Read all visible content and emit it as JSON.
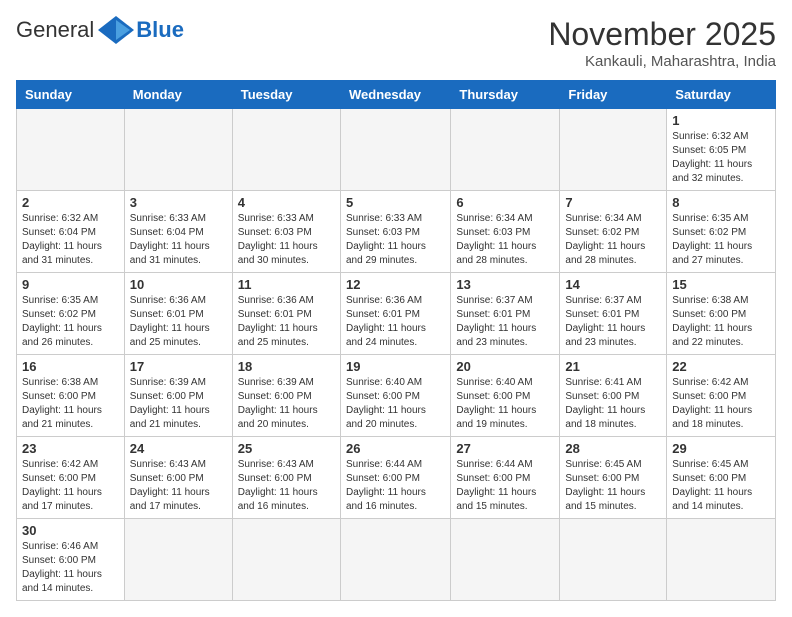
{
  "header": {
    "logo_general": "General",
    "logo_blue": "Blue",
    "month_year": "November 2025",
    "location": "Kankauli, Maharashtra, India"
  },
  "days_of_week": [
    "Sunday",
    "Monday",
    "Tuesday",
    "Wednesday",
    "Thursday",
    "Friday",
    "Saturday"
  ],
  "weeks": [
    [
      {
        "day": "",
        "content": ""
      },
      {
        "day": "",
        "content": ""
      },
      {
        "day": "",
        "content": ""
      },
      {
        "day": "",
        "content": ""
      },
      {
        "day": "",
        "content": ""
      },
      {
        "day": "",
        "content": ""
      },
      {
        "day": "1",
        "content": "Sunrise: 6:32 AM\nSunset: 6:05 PM\nDaylight: 11 hours\nand 32 minutes."
      }
    ],
    [
      {
        "day": "2",
        "content": "Sunrise: 6:32 AM\nSunset: 6:04 PM\nDaylight: 11 hours\nand 31 minutes."
      },
      {
        "day": "3",
        "content": "Sunrise: 6:33 AM\nSunset: 6:04 PM\nDaylight: 11 hours\nand 31 minutes."
      },
      {
        "day": "4",
        "content": "Sunrise: 6:33 AM\nSunset: 6:03 PM\nDaylight: 11 hours\nand 30 minutes."
      },
      {
        "day": "5",
        "content": "Sunrise: 6:33 AM\nSunset: 6:03 PM\nDaylight: 11 hours\nand 29 minutes."
      },
      {
        "day": "6",
        "content": "Sunrise: 6:34 AM\nSunset: 6:03 PM\nDaylight: 11 hours\nand 28 minutes."
      },
      {
        "day": "7",
        "content": "Sunrise: 6:34 AM\nSunset: 6:02 PM\nDaylight: 11 hours\nand 28 minutes."
      },
      {
        "day": "8",
        "content": "Sunrise: 6:35 AM\nSunset: 6:02 PM\nDaylight: 11 hours\nand 27 minutes."
      }
    ],
    [
      {
        "day": "9",
        "content": "Sunrise: 6:35 AM\nSunset: 6:02 PM\nDaylight: 11 hours\nand 26 minutes."
      },
      {
        "day": "10",
        "content": "Sunrise: 6:36 AM\nSunset: 6:01 PM\nDaylight: 11 hours\nand 25 minutes."
      },
      {
        "day": "11",
        "content": "Sunrise: 6:36 AM\nSunset: 6:01 PM\nDaylight: 11 hours\nand 25 minutes."
      },
      {
        "day": "12",
        "content": "Sunrise: 6:36 AM\nSunset: 6:01 PM\nDaylight: 11 hours\nand 24 minutes."
      },
      {
        "day": "13",
        "content": "Sunrise: 6:37 AM\nSunset: 6:01 PM\nDaylight: 11 hours\nand 23 minutes."
      },
      {
        "day": "14",
        "content": "Sunrise: 6:37 AM\nSunset: 6:01 PM\nDaylight: 11 hours\nand 23 minutes."
      },
      {
        "day": "15",
        "content": "Sunrise: 6:38 AM\nSunset: 6:00 PM\nDaylight: 11 hours\nand 22 minutes."
      }
    ],
    [
      {
        "day": "16",
        "content": "Sunrise: 6:38 AM\nSunset: 6:00 PM\nDaylight: 11 hours\nand 21 minutes."
      },
      {
        "day": "17",
        "content": "Sunrise: 6:39 AM\nSunset: 6:00 PM\nDaylight: 11 hours\nand 21 minutes."
      },
      {
        "day": "18",
        "content": "Sunrise: 6:39 AM\nSunset: 6:00 PM\nDaylight: 11 hours\nand 20 minutes."
      },
      {
        "day": "19",
        "content": "Sunrise: 6:40 AM\nSunset: 6:00 PM\nDaylight: 11 hours\nand 20 minutes."
      },
      {
        "day": "20",
        "content": "Sunrise: 6:40 AM\nSunset: 6:00 PM\nDaylight: 11 hours\nand 19 minutes."
      },
      {
        "day": "21",
        "content": "Sunrise: 6:41 AM\nSunset: 6:00 PM\nDaylight: 11 hours\nand 18 minutes."
      },
      {
        "day": "22",
        "content": "Sunrise: 6:42 AM\nSunset: 6:00 PM\nDaylight: 11 hours\nand 18 minutes."
      }
    ],
    [
      {
        "day": "23",
        "content": "Sunrise: 6:42 AM\nSunset: 6:00 PM\nDaylight: 11 hours\nand 17 minutes."
      },
      {
        "day": "24",
        "content": "Sunrise: 6:43 AM\nSunset: 6:00 PM\nDaylight: 11 hours\nand 17 minutes."
      },
      {
        "day": "25",
        "content": "Sunrise: 6:43 AM\nSunset: 6:00 PM\nDaylight: 11 hours\nand 16 minutes."
      },
      {
        "day": "26",
        "content": "Sunrise: 6:44 AM\nSunset: 6:00 PM\nDaylight: 11 hours\nand 16 minutes."
      },
      {
        "day": "27",
        "content": "Sunrise: 6:44 AM\nSunset: 6:00 PM\nDaylight: 11 hours\nand 15 minutes."
      },
      {
        "day": "28",
        "content": "Sunrise: 6:45 AM\nSunset: 6:00 PM\nDaylight: 11 hours\nand 15 minutes."
      },
      {
        "day": "29",
        "content": "Sunrise: 6:45 AM\nSunset: 6:00 PM\nDaylight: 11 hours\nand 14 minutes."
      }
    ],
    [
      {
        "day": "30",
        "content": "Sunrise: 6:46 AM\nSunset: 6:00 PM\nDaylight: 11 hours\nand 14 minutes."
      },
      {
        "day": "",
        "content": ""
      },
      {
        "day": "",
        "content": ""
      },
      {
        "day": "",
        "content": ""
      },
      {
        "day": "",
        "content": ""
      },
      {
        "day": "",
        "content": ""
      },
      {
        "day": "",
        "content": ""
      }
    ]
  ]
}
